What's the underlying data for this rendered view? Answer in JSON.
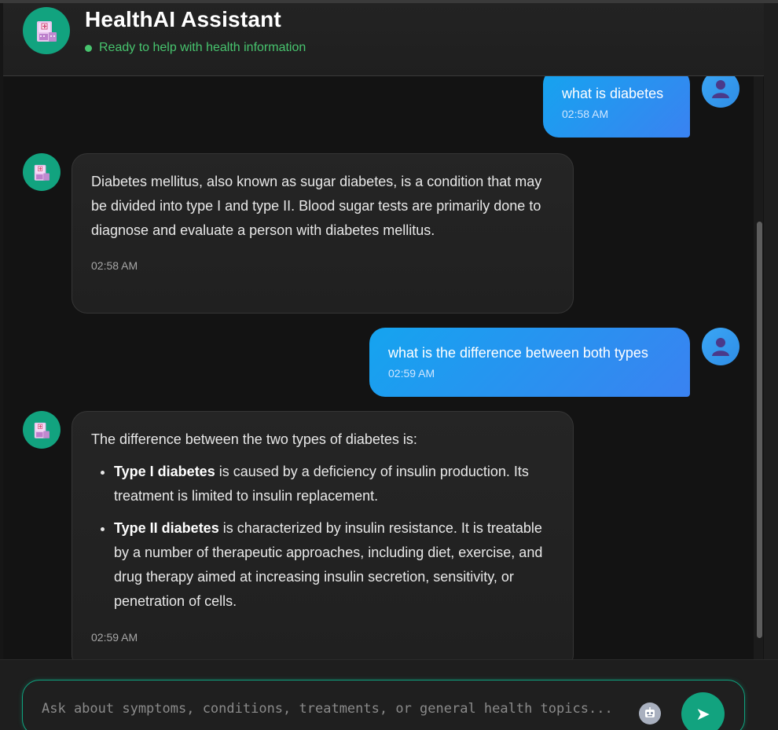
{
  "header": {
    "title": "HealthAI Assistant",
    "status": "Ready to help with health information",
    "status_color": "#47c46e",
    "avatar_icon": "hospital-icon"
  },
  "messages": [
    {
      "sender": "user",
      "text": "what is diabetes",
      "time": "02:58 AM"
    },
    {
      "sender": "bot",
      "text": "Diabetes mellitus, also known as sugar diabetes, is a condition that may be divided into type I and type II. Blood sugar tests are primarily done to diagnose and evaluate a person with diabetes mellitus.",
      "time": "02:58 AM"
    },
    {
      "sender": "user",
      "text": "what is the difference between both types",
      "time": "02:59 AM"
    },
    {
      "sender": "bot",
      "intro": "The difference between the two types of diabetes is:",
      "items": [
        {
          "bold": "Type I diabetes",
          "rest": " is caused by a deficiency of insulin production. Its treatment is limited to insulin replacement."
        },
        {
          "bold": "Type II diabetes",
          "rest": " is characterized by insulin resistance. It is treatable by a number of therapeutic approaches, including diet, exercise, and drug therapy aimed at increasing insulin secretion, sensitivity, or penetration of cells."
        }
      ],
      "time": "02:59 AM"
    }
  ],
  "input": {
    "placeholder": "Ask about symptoms, conditions, treatments, or general health topics...",
    "value": ""
  },
  "send_icon": "➤",
  "colors": {
    "accent": "#12a37f",
    "user_bubble_start": "#15a4ef",
    "user_bubble_end": "#3a82f1"
  }
}
